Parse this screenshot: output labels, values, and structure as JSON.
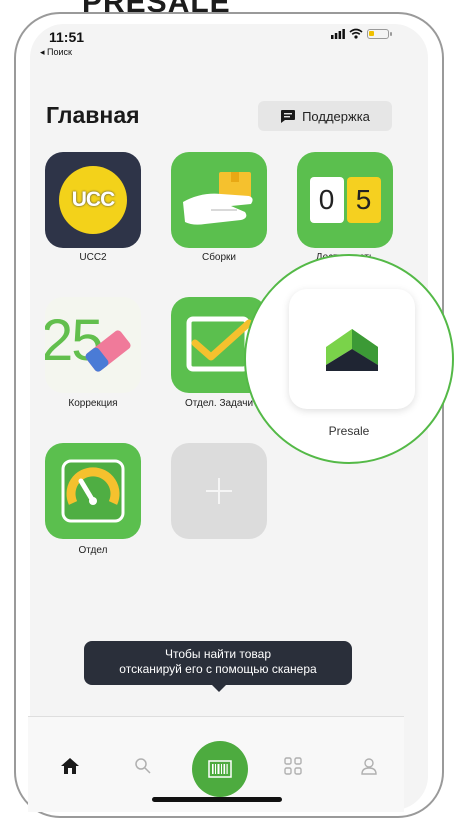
{
  "header_caption": "PRESALE",
  "status_bar": {
    "time": "11:51",
    "back_label": "◂ Поиск"
  },
  "main": {
    "title": "Главная",
    "support_label": "Поддержка",
    "apps": [
      {
        "label": "UCC2",
        "logo_text": "UCC"
      },
      {
        "label": "Сборки"
      },
      {
        "label": "Доступность",
        "digits": [
          "0",
          "5"
        ]
      },
      {
        "label": "Коррекция",
        "art_text": "25"
      },
      {
        "label": "Отдел. Задачи"
      },
      {
        "label": "Отдел"
      }
    ],
    "highlight": {
      "label": "Presale"
    },
    "tooltip": {
      "line1": "Чтобы найти товар",
      "line2": "отсканируй его с помощью сканера"
    }
  },
  "tab_bar": {
    "tabs": [
      "home-icon",
      "search-icon",
      "barcode-scan-icon",
      "grid-icon",
      "profile-icon"
    ],
    "accent": "#4dab3f"
  },
  "colors": {
    "brand_green": "#5bbf4e",
    "ucc_dark": "#2e3448",
    "ucc_yellow": "#f3d21a"
  }
}
